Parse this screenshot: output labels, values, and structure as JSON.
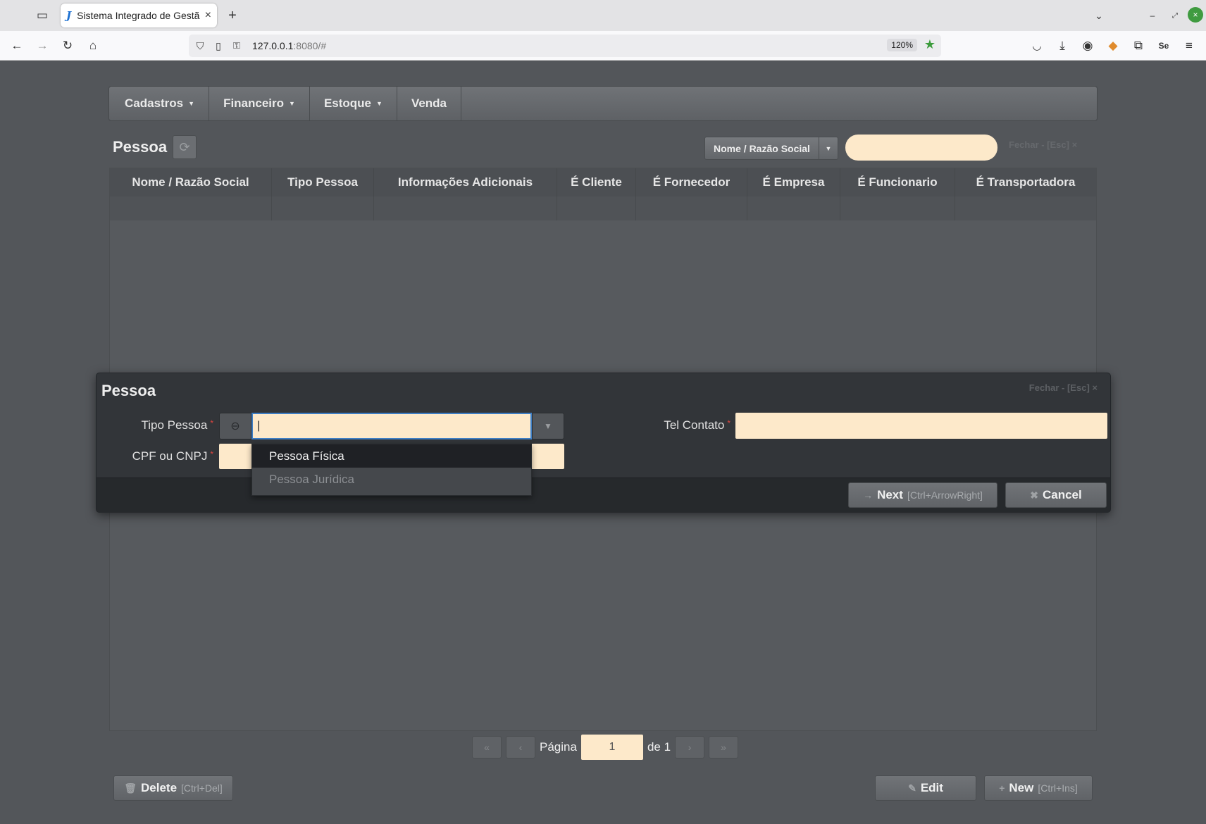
{
  "browser": {
    "tab_title": "Sistema Integrado de Gestã",
    "tab_favicon": "J",
    "url_host": "127.0.0.1",
    "url_rest": ":8080/#",
    "zoom": "120%"
  },
  "menu": [
    {
      "label": "Cadastros",
      "has_caret": true
    },
    {
      "label": "Financeiro",
      "has_caret": true
    },
    {
      "label": "Estoque",
      "has_caret": true
    },
    {
      "label": "Venda",
      "has_caret": false
    }
  ],
  "page": {
    "title": "Pessoa",
    "search_field_label": "Nome / Razão Social",
    "close_label": "Fechar - [Esc]",
    "close_x": "×"
  },
  "grid": {
    "columns": [
      "Nome / Razão Social",
      "Tipo Pessoa",
      "Informações Adicionais",
      "É Cliente",
      "É Fornecedor",
      "É Empresa",
      "É Funcionario",
      "É Transportadora"
    ]
  },
  "pager": {
    "page_label": "Página",
    "page_value": "1",
    "of_label": "de 1"
  },
  "buttons": {
    "delete_label": "Delete",
    "delete_hint": "[Ctrl+Del]",
    "edit_label": "Edit",
    "new_label": "New",
    "new_hint": "[Ctrl+Ins]"
  },
  "modal": {
    "title": "Pessoa",
    "close_label": "Fechar - [Esc]",
    "close_x": "×",
    "tipo_label": "Tipo Pessoa",
    "cpf_label": "CPF ou CNPJ",
    "tel_label": "Tel Contato",
    "required_mark": "*",
    "tipo_options": [
      "Pessoa Física",
      "Pessoa Jurídica"
    ],
    "next_label": "Next",
    "next_hint": "[Ctrl+ArrowRight]",
    "cancel_label": "Cancel"
  },
  "colors": {
    "input_bg": "#fde9ca",
    "required": "#d9443f",
    "focus_border": "#3e7ec4"
  }
}
